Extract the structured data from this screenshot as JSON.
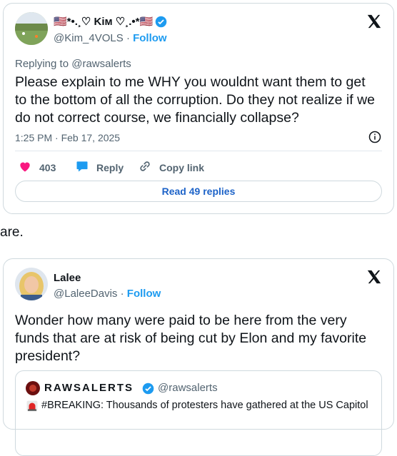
{
  "tweet1": {
    "display_name": "🇺🇸*•.¸♡ Kім ♡¸.•*🇺🇸",
    "handle": "@Kim_4VOLS",
    "separator": "·",
    "follow_label": "Follow",
    "replying_prefix": "Replying to",
    "replying_to": "@rawsalerts",
    "text": "Please explain to me WHY you wouldnt want them to get to the bottom of all the corruption.  Do they not realize if we do not correct course, we financially collapse?",
    "timestamp": "1:25 PM · Feb 17, 2025",
    "like_count": "403",
    "reply_label": "Reply",
    "copy_link_label": "Copy link",
    "read_replies_label": "Read 49 replies"
  },
  "between_text": "are.",
  "tweet2": {
    "display_name": "Lalee",
    "handle": "@LaleeDavis",
    "separator": "·",
    "follow_label": "Follow",
    "text": "Wonder how many were paid to be here from the very funds that are at risk of being cut by Elon and my favorite president?",
    "quote": {
      "display_name": "RAWSALERTS",
      "handle": "@rawsalerts",
      "text": "#BREAKING: Thousands of protesters have gathered at the US Capitol"
    }
  },
  "colors": {
    "accent_blue": "#1d9bf0",
    "like_pink": "#f91880",
    "border": "#cfd9de",
    "muted": "#536471"
  },
  "icons": [
    "verified-badge-icon",
    "x-logo-icon",
    "info-icon",
    "heart-icon",
    "reply-bubble-icon",
    "link-icon",
    "siren-icon"
  ]
}
